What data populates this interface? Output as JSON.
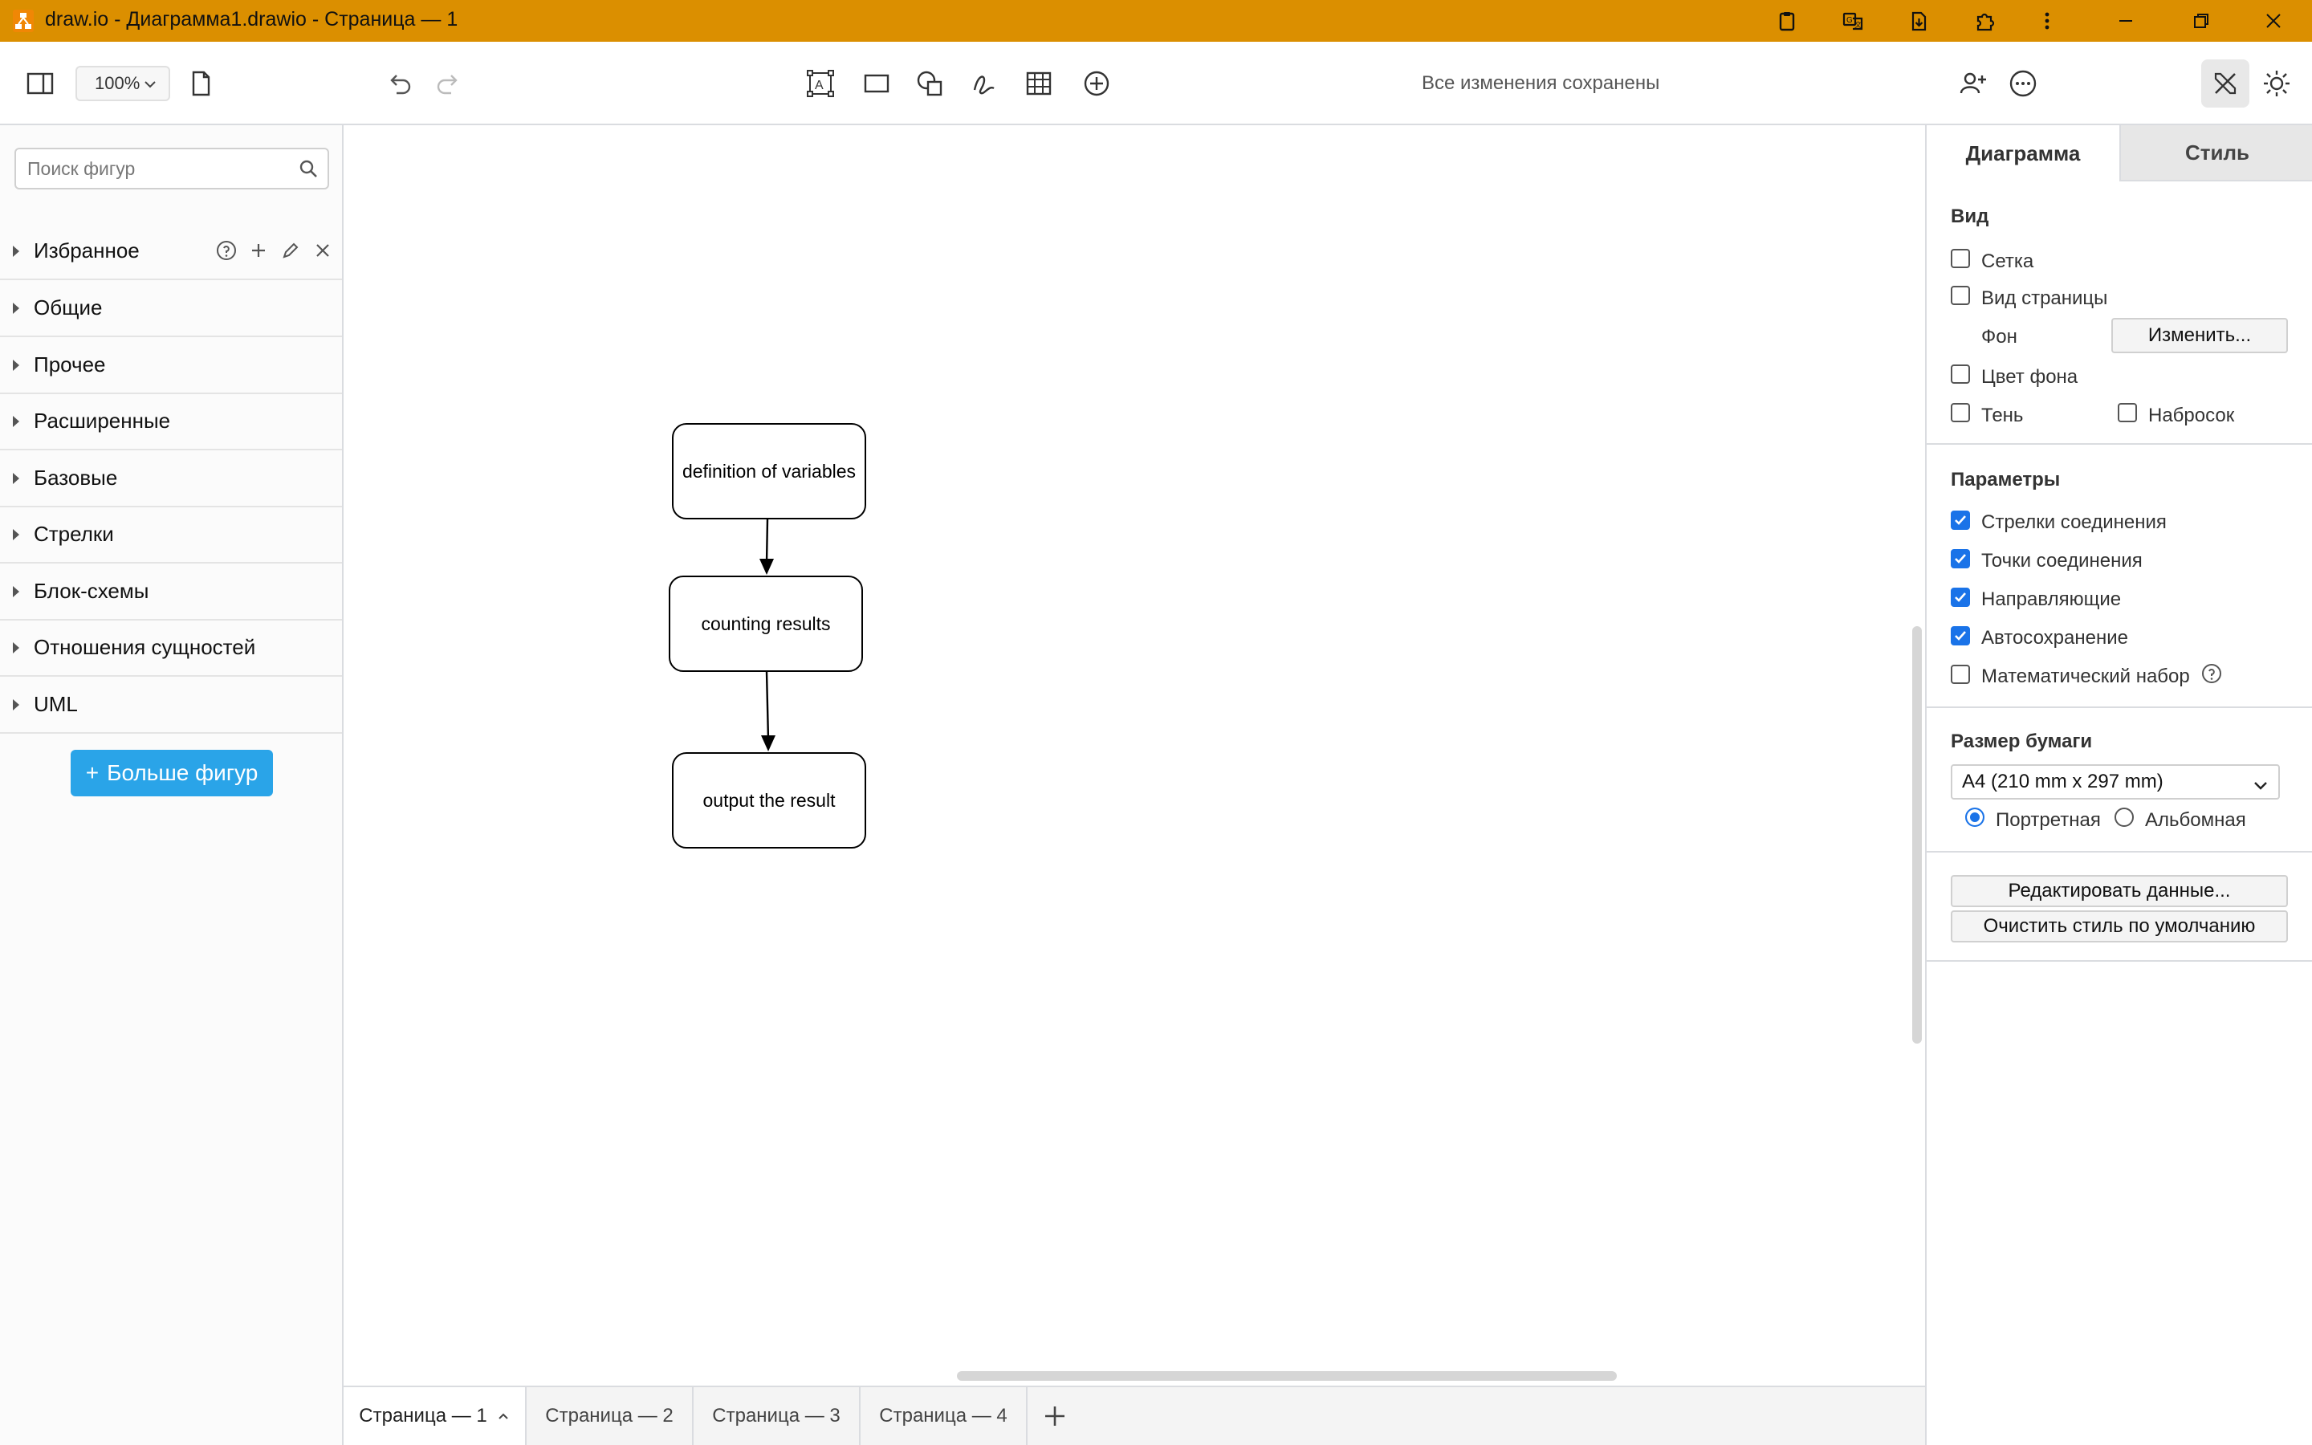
{
  "window": {
    "title": "draw.io - Диаграмма1.drawio - Страница — 1",
    "accent": "#db8f00"
  },
  "toolbar": {
    "zoom": "100%",
    "status": "Все изменения сохранены"
  },
  "sidebar": {
    "search_placeholder": "Поиск фигур",
    "categories": [
      {
        "label": "Избранное"
      },
      {
        "label": "Общие"
      },
      {
        "label": "Прочее"
      },
      {
        "label": "Расширенные"
      },
      {
        "label": "Базовые"
      },
      {
        "label": "Стрелки"
      },
      {
        "label": "Блок-схемы"
      },
      {
        "label": "Отношения сущностей"
      },
      {
        "label": "UML"
      }
    ],
    "more_shapes_label": "Больше фигур"
  },
  "diagram": {
    "nodes": [
      {
        "label": "definition of variables"
      },
      {
        "label": "counting results"
      },
      {
        "label": "output the result"
      }
    ]
  },
  "tabs": [
    {
      "label": "Страница — 1"
    },
    {
      "label": "Страница — 2"
    },
    {
      "label": "Страница — 3"
    },
    {
      "label": "Страница — 4"
    }
  ],
  "panel": {
    "tabs": [
      "Диаграмма",
      "Стиль"
    ],
    "view": {
      "title": "Вид",
      "grid": "Сетка",
      "page_view": "Вид страницы",
      "background": "Фон",
      "change": "Изменить...",
      "bg_color": "Цвет фона",
      "shadow": "Тень",
      "sketch": "Набросок"
    },
    "options": {
      "title": "Параметры",
      "connection_arrows": "Стрелки соединения",
      "connection_points": "Точки соединения",
      "guides": "Направляющие",
      "autosave": "Автосохранение",
      "math": "Математический набор"
    },
    "paper": {
      "title": "Размер бумаги",
      "size": "A4 (210 mm x 297 mm)",
      "portrait": "Портретная",
      "landscape": "Альбомная"
    },
    "edit_data": "Редактировать данные...",
    "clear_style": "Очистить стиль по умолчанию"
  }
}
